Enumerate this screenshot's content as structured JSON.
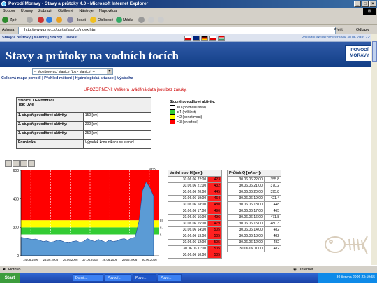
{
  "window": {
    "title": "Povodí Moravy - Stavy a průtoky 4.0 - Microsoft Internet Explorer"
  },
  "menu": [
    "Soubor",
    "Úpravy",
    "Zobrazit",
    "Oblíbené",
    "Nástroje",
    "Nápověda"
  ],
  "toolbar": {
    "back": "Zpět",
    "search": "Hledat",
    "favorites": "Oblíbené",
    "media": "Média"
  },
  "address": {
    "label": "Adresa",
    "url": "http://www.pmo.cz/portal/sap/cz/index.htm",
    "go": "Přejít",
    "links": "Odkazy"
  },
  "page": {
    "nav": "Stavy a průtoky | Nádrže | Srážky | Jakost",
    "last_update": "Poslední aktualizace stránek 30.06.2006 22:15",
    "banner_title": "Stavy a průtoky na vodních tocích",
    "logo_line1": "POVODÍ",
    "logo_line2": "MORAVY",
    "station_select": "-- Monitorovací stanice (tok - stanice) --",
    "subnav": "Celková mapa povodí | Přehled měření | Hydrologická situace | Výstraha",
    "warning": "UPOZORNĚNÍ: Veškerá uváděná data jsou bez záruky."
  },
  "station": {
    "header_line1": "Stanice: LG Podhradí",
    "header_line2": "Tok: Dyje",
    "rows": [
      {
        "label": "1. stupeň povodňové aktivity:",
        "value": "150 [cm]"
      },
      {
        "label": "2. stupeň povodňové aktivity:",
        "value": "200 [cm]"
      },
      {
        "label": "3. stupeň povodňové aktivity:",
        "value": "250 [cm]"
      },
      {
        "label": "Poznámka:",
        "value": "Výpadek komunikace se stanicí."
      }
    ]
  },
  "legend": {
    "title": "Stupně povodňové aktivity:",
    "items": [
      {
        "label": "= 0 (normální stav)",
        "color": "#ffffff"
      },
      {
        "label": "= 1 (bdělost)",
        "color": "#33cc33"
      },
      {
        "label": "= 2 (pohotovost)",
        "color": "#ffff00"
      },
      {
        "label": "= 3 (ohrožení)",
        "color": "#ff0000"
      }
    ]
  },
  "chart_data": {
    "type": "area",
    "title": "",
    "corner_label": "SPA",
    "yticks": [
      "600",
      "400",
      "200",
      "0"
    ],
    "ylim": [
      0,
      600
    ],
    "x": [
      "24.06.2006",
      "25.06.2006",
      "26.06.2006",
      "27.06.2006",
      "28.06.2006",
      "29.06.2006",
      "30.06.2006"
    ],
    "bands": [
      {
        "level": "1",
        "from": 150,
        "to": 200,
        "color": "#33cc33"
      },
      {
        "level": "2",
        "from": 200,
        "to": 250,
        "color": "#ffff00"
      },
      {
        "level": "3",
        "from": 250,
        "to": 600,
        "color": "#ff0000"
      }
    ],
    "band_labels": [
      "III.",
      "II.",
      "I."
    ],
    "series": [
      {
        "values": [
          130,
          125,
          120,
          115,
          118,
          110,
          100,
          105,
          95,
          100,
          110,
          105,
          95,
          90,
          100,
          105,
          95,
          100,
          120,
          110,
          100,
          115,
          105,
          95,
          110,
          100,
          105,
          115,
          120,
          110,
          125,
          130,
          240,
          460,
          520,
          480,
          420
        ]
      }
    ]
  },
  "water_level": {
    "header": "Vodní stav H [cm]:",
    "rows": [
      {
        "time": "30.06.06 22:00",
        "value": "423"
      },
      {
        "time": "30.06.06 21:00",
        "value": "432"
      },
      {
        "time": "30.06.06 20:00",
        "value": "445"
      },
      {
        "time": "30.06.06 19:00",
        "value": "464"
      },
      {
        "time": "30.06.06 18:00",
        "value": "480"
      },
      {
        "time": "30.06.06 17:00",
        "value": "490"
      },
      {
        "time": "30.06.06 16:00",
        "value": "496"
      },
      {
        "time": "30.06.06 15:00",
        "value": "479"
      },
      {
        "time": "30.06.06 14:00",
        "value": "505"
      },
      {
        "time": "30.06.06 13:00",
        "value": "505"
      },
      {
        "time": "30.06.06 12:00",
        "value": "505"
      },
      {
        "time": "30.06.06 11:00",
        "value": "505"
      },
      {
        "time": "30.06.06 10:00",
        "value": "505"
      }
    ]
  },
  "discharge": {
    "header": "Průtok Q [m³.s⁻¹]:",
    "rows": [
      {
        "time": "30.06.06 22:00",
        "value": "355.8"
      },
      {
        "time": "30.06.06 21:00",
        "value": "370.2"
      },
      {
        "time": "30.06.06 20:00",
        "value": "395.8"
      },
      {
        "time": "30.06.06 19:00",
        "value": "421.4"
      },
      {
        "time": "30.06.06 18:00",
        "value": "448"
      },
      {
        "time": "30.06.06 17:00",
        "value": "465"
      },
      {
        "time": "30.06.06 16:00",
        "value": "471.8"
      },
      {
        "time": "30.06.06 15:00",
        "value": "480.3"
      },
      {
        "time": "30.06.06 14:00",
        "value": "482"
      },
      {
        "time": "30.06.06 13:00",
        "value": "482"
      },
      {
        "time": "30.06.06 12:00",
        "value": "482"
      },
      {
        "time": "30.06.06 11:00",
        "value": "482"
      }
    ]
  },
  "status": {
    "left": "Hotovo",
    "zone": "Internet"
  },
  "taskbar": {
    "start": "Start",
    "tasks": [
      "Doruč...",
      "Povodí...",
      "Povo...",
      "Povo..."
    ],
    "clock": "30 června 2006  23:19:55"
  },
  "colors": {
    "alert_red": "#ff0000",
    "link_blue": "#1f3c88",
    "banner_blue": "#123e86"
  }
}
